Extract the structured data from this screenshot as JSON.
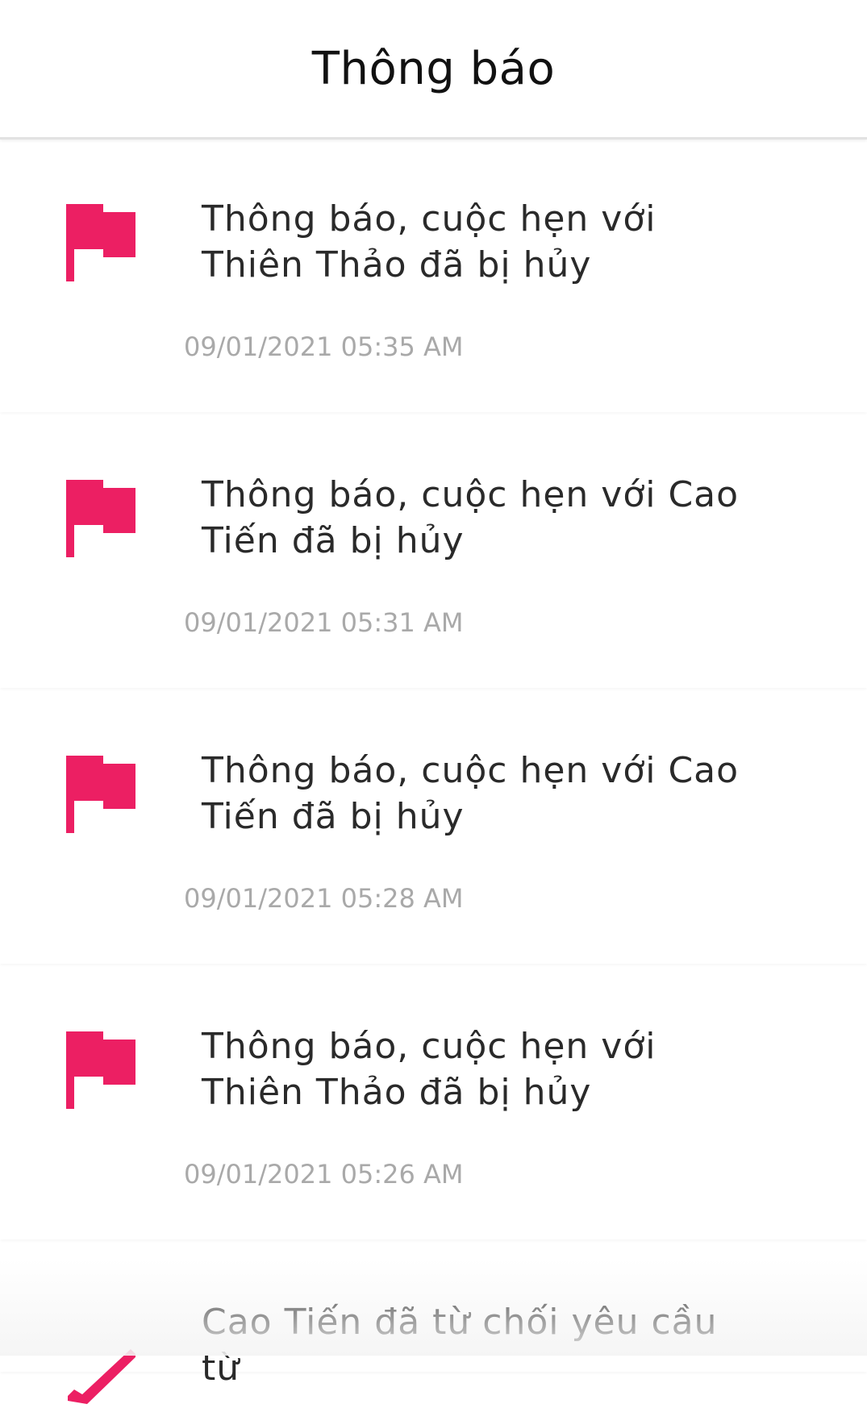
{
  "header": {
    "title": "Thông báo"
  },
  "colors": {
    "accent": "#ec1f63",
    "text": "#2a2a2a",
    "muted": "#a9a9a9"
  },
  "notifications": [
    {
      "icon": "flag-icon",
      "message": "Thông báo, cuộc hẹn với Thiên Thảo đã bị hủy",
      "time": "09/01/2021 05:35 AM"
    },
    {
      "icon": "flag-icon",
      "message": "Thông báo, cuộc hẹn với Cao Tiến đã bị hủy",
      "time": "09/01/2021 05:31 AM"
    },
    {
      "icon": "flag-icon",
      "message": "Thông báo, cuộc hẹn với Cao Tiến đã bị hủy",
      "time": "09/01/2021 05:28 AM"
    },
    {
      "icon": "flag-icon",
      "message": "Thông báo, cuộc hẹn với Thiên Thảo đã bị hủy",
      "time": "09/01/2021 05:26 AM"
    },
    {
      "icon": "pencil-icon",
      "message": "Cao Tiến đã từ chối yêu cầu từ"
    }
  ]
}
